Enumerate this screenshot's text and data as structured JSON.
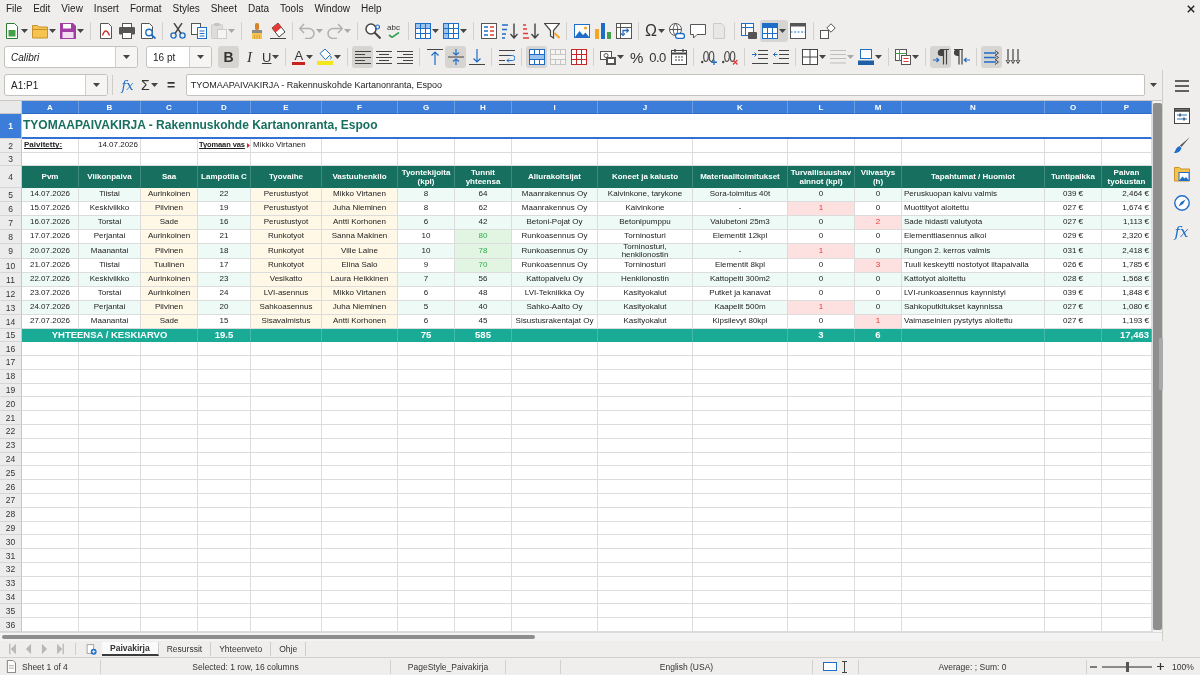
{
  "menu_bar": {
    "items": [
      "File",
      "Edit",
      "View",
      "Insert",
      "Format",
      "Styles",
      "Sheet",
      "Data",
      "Tools",
      "Window",
      "Help"
    ]
  },
  "standard_toolbar": {
    "groups": [
      [
        {
          "kind": "new",
          "dropdown": true,
          "pressed": false,
          "disabled": false
        },
        {
          "kind": "open",
          "dropdown": true,
          "pressed": false,
          "disabled": false
        },
        {
          "kind": "save",
          "dropdown": true,
          "pressed": false,
          "disabled": false
        }
      ],
      [
        {
          "kind": "pdf",
          "dropdown": false,
          "pressed": false,
          "disabled": false
        },
        {
          "kind": "print",
          "dropdown": false,
          "pressed": false,
          "disabled": false
        },
        {
          "kind": "preview",
          "dropdown": false,
          "pressed": false,
          "disabled": false
        }
      ],
      [
        {
          "kind": "cut",
          "dropdown": false,
          "pressed": false,
          "disabled": false
        },
        {
          "kind": "copy",
          "dropdown": false,
          "pressed": false,
          "disabled": false
        },
        {
          "kind": "paste",
          "dropdown": true,
          "pressed": false,
          "disabled": true
        }
      ],
      [
        {
          "kind": "clone",
          "dropdown": false,
          "pressed": false,
          "disabled": false
        },
        {
          "kind": "clear",
          "dropdown": false,
          "pressed": false,
          "disabled": false
        }
      ],
      [
        {
          "kind": "undo",
          "dropdown": true,
          "pressed": false,
          "disabled": true
        },
        {
          "kind": "redo",
          "dropdown": true,
          "pressed": false,
          "disabled": true
        }
      ],
      [
        {
          "kind": "find",
          "dropdown": false,
          "pressed": false,
          "disabled": false
        },
        {
          "kind": "spelling",
          "glyph": "abc",
          "dropdown": false,
          "pressed": false,
          "disabled": false
        }
      ],
      [
        {
          "kind": "rows",
          "dropdown": true,
          "pressed": false,
          "disabled": false
        },
        {
          "kind": "columns",
          "dropdown": true,
          "pressed": false,
          "disabled": false
        }
      ],
      [
        {
          "kind": "sort",
          "dropdown": false,
          "pressed": false,
          "disabled": false
        },
        {
          "kind": "ascending",
          "dropdown": false,
          "pressed": false,
          "disabled": false
        },
        {
          "kind": "descending",
          "dropdown": false,
          "pressed": false,
          "disabled": false
        },
        {
          "kind": "filter",
          "dropdown": false,
          "pressed": false,
          "disabled": false
        }
      ],
      [
        {
          "kind": "image",
          "dropdown": false,
          "pressed": false,
          "disabled": false
        },
        {
          "kind": "chart",
          "dropdown": false,
          "pressed": false,
          "disabled": false
        },
        {
          "kind": "pivot",
          "dropdown": false,
          "pressed": false,
          "disabled": false
        }
      ],
      [
        {
          "kind": "symbol",
          "glyph": "Ω",
          "dropdown": true,
          "pressed": false,
          "disabled": false
        },
        {
          "kind": "hyperlink",
          "dropdown": false,
          "pressed": false,
          "disabled": false
        },
        {
          "kind": "comment",
          "dropdown": false,
          "pressed": false,
          "disabled": false
        },
        {
          "kind": "headers",
          "dropdown": false,
          "pressed": false,
          "disabled": true
        }
      ],
      [
        {
          "kind": "printrange",
          "dropdown": false,
          "pressed": false,
          "disabled": false
        },
        {
          "kind": "freeze",
          "dropdown": true,
          "pressed": true,
          "disabled": false
        },
        {
          "kind": "split",
          "dropdown": false,
          "pressed": false,
          "disabled": false
        }
      ],
      [
        {
          "kind": "shapes",
          "dropdown": false,
          "pressed": false,
          "disabled": false
        }
      ]
    ]
  },
  "formatting_toolbar": {
    "font_name": "Calibri",
    "font_size": "16 pt",
    "groups": [
      [
        {
          "kind": "bold",
          "glyph": "B",
          "dropdown": false,
          "pressed": true,
          "disabled": false
        },
        {
          "kind": "italic",
          "glyph": "I",
          "dropdown": false,
          "pressed": false,
          "disabled": false
        },
        {
          "kind": "underline",
          "glyph": "U",
          "dropdown": true,
          "pressed": false,
          "disabled": false
        }
      ],
      [
        {
          "kind": "fontcolor",
          "glyph": "A",
          "dropdown": true,
          "pressed": false,
          "disabled": false
        },
        {
          "kind": "highlight",
          "dropdown": true,
          "pressed": false,
          "disabled": false
        }
      ],
      [
        {
          "kind": "left",
          "dropdown": false,
          "pressed": true,
          "disabled": false
        },
        {
          "kind": "center",
          "dropdown": false,
          "pressed": false,
          "disabled": false
        },
        {
          "kind": "right",
          "dropdown": false,
          "pressed": false,
          "disabled": false
        }
      ],
      [
        {
          "kind": "top",
          "dropdown": false,
          "pressed": false,
          "disabled": false
        },
        {
          "kind": "middle",
          "dropdown": false,
          "pressed": true,
          "disabled": false
        },
        {
          "kind": "bottom",
          "dropdown": false,
          "pressed": false,
          "disabled": false
        }
      ],
      [
        {
          "kind": "wrap",
          "dropdown": false,
          "pressed": false,
          "disabled": false
        }
      ],
      [
        {
          "kind": "mergecenter",
          "dropdown": false,
          "pressed": true,
          "disabled": false
        },
        {
          "kind": "merge",
          "dropdown": false,
          "pressed": false,
          "disabled": true
        },
        {
          "kind": "unmerge",
          "dropdown": false,
          "pressed": false,
          "disabled": false
        }
      ],
      [
        {
          "kind": "currency",
          "dropdown": true,
          "pressed": false,
          "disabled": false
        },
        {
          "kind": "percent",
          "glyph": "%",
          "dropdown": false,
          "pressed": false,
          "disabled": false
        },
        {
          "kind": "number",
          "glyph": "0.0",
          "dropdown": false,
          "pressed": false,
          "disabled": false
        },
        {
          "kind": "date",
          "dropdown": false,
          "pressed": false,
          "disabled": false
        }
      ],
      [
        {
          "kind": "adddecimal",
          "dropdown": false,
          "pressed": false,
          "disabled": false
        },
        {
          "kind": "deldecimal",
          "dropdown": false,
          "pressed": false,
          "disabled": false
        }
      ],
      [
        {
          "kind": "indent",
          "dropdown": false,
          "pressed": false,
          "disabled": false
        },
        {
          "kind": "outdent",
          "dropdown": false,
          "pressed": false,
          "disabled": false
        }
      ],
      [
        {
          "kind": "borders",
          "dropdown": true,
          "pressed": false,
          "disabled": false
        },
        {
          "kind": "borderstyle",
          "dropdown": true,
          "pressed": false,
          "disabled": true
        },
        {
          "kind": "bordercolor",
          "dropdown": true,
          "pressed": false,
          "disabled": false
        }
      ],
      [
        {
          "kind": "conditional",
          "dropdown": true,
          "pressed": false,
          "disabled": false
        }
      ],
      [
        {
          "kind": "ltr",
          "dropdown": false,
          "pressed": true,
          "disabled": false
        },
        {
          "kind": "rtl",
          "dropdown": false,
          "pressed": false,
          "disabled": false
        }
      ],
      [
        {
          "kind": "horizontal",
          "dropdown": false,
          "pressed": true,
          "disabled": false
        },
        {
          "kind": "vertical",
          "dropdown": false,
          "pressed": false,
          "disabled": false
        }
      ]
    ]
  },
  "formula_bar": {
    "name_box": "A1:P1",
    "buttons": [
      {
        "kind": "wizard",
        "glyph": "fx",
        "dropdown": false
      },
      {
        "kind": "sum",
        "glyph": "Σ",
        "dropdown": true
      },
      {
        "kind": "equals",
        "glyph": "=",
        "dropdown": false
      }
    ],
    "formula": "TYOMAAPAIVAKIRJA - Rakennuskohde Kartanonranta, Espoo"
  },
  "sidebar": {
    "buttons": [
      {
        "kind": "properties",
        "selected": false
      },
      {
        "kind": "styles",
        "selected": false
      },
      {
        "kind": "gallery",
        "selected": false
      },
      {
        "kind": "navigator",
        "selected": false
      },
      {
        "kind": "functions",
        "glyph": "fx",
        "selected": false
      }
    ]
  },
  "sheet": {
    "column_headers": [
      {
        "label": "A",
        "selected": true
      },
      {
        "label": "B",
        "selected": true
      },
      {
        "label": "C",
        "selected": true
      },
      {
        "label": "D",
        "selected": true
      },
      {
        "label": "E",
        "selected": true
      },
      {
        "label": "F",
        "selected": true
      },
      {
        "label": "G",
        "selected": true
      },
      {
        "label": "H",
        "selected": true
      },
      {
        "label": "I",
        "selected": true
      },
      {
        "label": "J",
        "selected": true
      },
      {
        "label": "K",
        "selected": true
      },
      {
        "label": "L",
        "selected": true
      },
      {
        "label": "M",
        "selected": true
      },
      {
        "label": "N",
        "selected": true
      },
      {
        "label": "O",
        "selected": true
      },
      {
        "label": "P",
        "selected": true
      }
    ],
    "row_headers": [
      {
        "label": "1",
        "selected": true
      },
      {
        "label": "2",
        "selected": false
      },
      {
        "label": "3",
        "selected": false
      },
      {
        "label": "4",
        "selected": false
      },
      {
        "label": "5",
        "selected": false
      },
      {
        "label": "6",
        "selected": false
      },
      {
        "label": "7",
        "selected": false
      },
      {
        "label": "8",
        "selected": false
      },
      {
        "label": "9",
        "selected": false
      },
      {
        "label": "10",
        "selected": false
      },
      {
        "label": "11",
        "selected": false
      },
      {
        "label": "12",
        "selected": false
      },
      {
        "label": "13",
        "selected": false
      },
      {
        "label": "14",
        "selected": false
      },
      {
        "label": "15",
        "selected": false
      },
      {
        "label": "16",
        "selected": false
      },
      {
        "label": "17",
        "selected": false
      },
      {
        "label": "18",
        "selected": false
      },
      {
        "label": "19",
        "selected": false
      },
      {
        "label": "20",
        "selected": false
      },
      {
        "label": "21",
        "selected": false
      },
      {
        "label": "22",
        "selected": false
      },
      {
        "label": "23",
        "selected": false
      },
      {
        "label": "24",
        "selected": false
      },
      {
        "label": "25",
        "selected": false
      },
      {
        "label": "26",
        "selected": false
      },
      {
        "label": "27",
        "selected": false
      },
      {
        "label": "28",
        "selected": false
      },
      {
        "label": "29",
        "selected": false
      },
      {
        "label": "30",
        "selected": false
      },
      {
        "label": "31",
        "selected": false
      },
      {
        "label": "32",
        "selected": false
      },
      {
        "label": "33",
        "selected": false
      },
      {
        "label": "34",
        "selected": false
      },
      {
        "label": "35",
        "selected": false
      },
      {
        "label": "36",
        "selected": false
      }
    ],
    "title": "TYOMAAPAIVAKIRJA - Rakennuskohde Kartanonranta, Espoo",
    "info": {
      "updated": {
        "label": "Paivitetty:",
        "value": "14.07.2026"
      },
      "manager": {
        "label": "Tyomaan vas",
        "label_clipped": true,
        "value": "Mikko Virtanen"
      }
    },
    "table": {
      "columns": [
        "Pvm",
        "Viikonpaiva",
        "Saa",
        "Lampotila C",
        "Tyovaihe",
        "Vastuuhenkilo",
        "Tyontekijoita (kpl)",
        "Tunnit yhteensa",
        "Aliurakoitsijat",
        "Koneet ja kalusto",
        "Materiaalitoimitukset",
        "Turvallisuushavainnot (kpl)",
        "Viivastys (h)",
        "Tapahtumat / Huomiot",
        "Tuntipalkka",
        "Paivan tyokustan"
      ],
      "rows": [
        {
          "cells": [
            "14.07.2026",
            "Tiistai",
            "Aurinkoinen",
            "22",
            "Perustustyot",
            "Mikko Virtanen",
            "8",
            "64",
            "Maanrakennus Oy",
            "Kaivinkone, tarykone",
            "Sora-toimitus 40t",
            "0",
            "0",
            "Peruskuopan kaivu valmis",
            "039 €",
            "2,464 €"
          ],
          "hours_high": false,
          "incident": false,
          "delayed": false
        },
        {
          "cells": [
            "15.07.2026",
            "Keskiviikko",
            "Pilvinen",
            "19",
            "Perustustyot",
            "Juha Nieminen",
            "8",
            "62",
            "Maanrakennus Oy",
            "Kaivinkone",
            "-",
            "1",
            "0",
            "Muottityot aloitettu",
            "027 €",
            "1,674 €"
          ],
          "hours_high": false,
          "incident": true,
          "delayed": false
        },
        {
          "cells": [
            "16.07.2026",
            "Torstai",
            "Sade",
            "16",
            "Perustustyot",
            "Antti Korhonen",
            "6",
            "42",
            "Betoni-Pojat Oy",
            "Betonipumppu",
            "Valubetoni 25m3",
            "0",
            "2",
            "Sade hidasti valutyota",
            "027 €",
            "1,113 €"
          ],
          "hours_high": false,
          "incident": false,
          "delayed": true
        },
        {
          "cells": [
            "17.07.2026",
            "Perjantai",
            "Aurinkoinen",
            "21",
            "Runkotyot",
            "Sanna Makinen",
            "10",
            "80",
            "Runkoasennus Oy",
            "Torninosturi",
            "Elementit 12kpl",
            "0",
            "0",
            "Elementtiasennus alkoi",
            "029 €",
            "2,320 €"
          ],
          "hours_high": true,
          "incident": false,
          "delayed": false
        },
        {
          "cells": [
            "20.07.2026",
            "Maanantai",
            "Pilvinen",
            "18",
            "Runkotyot",
            "Ville Laine",
            "10",
            "78",
            "Runkoasennus Oy",
            "Torninosturi, henkilonostin",
            "-",
            "1",
            "0",
            "Rungon 2. kerros valmis",
            "031 €",
            "2,418 €"
          ],
          "hours_high": true,
          "incident": true,
          "delayed": false
        },
        {
          "cells": [
            "21.07.2026",
            "Tiistai",
            "Tuulinen",
            "17",
            "Runkotyot",
            "Elina Salo",
            "9",
            "70",
            "Runkoasennus Oy",
            "Torninosturi",
            "Elementit 8kpl",
            "0",
            "3",
            "Tuuli keskeytti nostotyot iltapaivalla",
            "026 €",
            "1,785 €"
          ],
          "hours_high": true,
          "incident": false,
          "delayed": true
        },
        {
          "cells": [
            "22.07.2026",
            "Keskiviikko",
            "Aurinkoinen",
            "23",
            "Vesikatto",
            "Laura Heikkinen",
            "7",
            "56",
            "Kattopalvelu Oy",
            "Henkilonostin",
            "Kattopelti 300m2",
            "0",
            "0",
            "Kattotyot aloitettu",
            "028 €",
            "1,568 €"
          ],
          "hours_high": false,
          "incident": false,
          "delayed": false
        },
        {
          "cells": [
            "23.07.2026",
            "Torstai",
            "Aurinkoinen",
            "24",
            "LVI-asennus",
            "Mikko Virtanen",
            "6",
            "48",
            "LVI-Tekniikka Oy",
            "Kasityokalut",
            "Putket ja kanavat",
            "0",
            "0",
            "LVI-runkoasennus kaynnistyi",
            "039 €",
            "1,848 €"
          ],
          "hours_high": false,
          "incident": false,
          "delayed": false
        },
        {
          "cells": [
            "24.07.2026",
            "Perjantai",
            "Pilvinen",
            "20",
            "Sahkoasennus",
            "Juha Nieminen",
            "5",
            "40",
            "Sahko-Aalto Oy",
            "Kasityokalut",
            "Kaapelit 500m",
            "1",
            "0",
            "Sahkoputkitukset kaynnissa",
            "027 €",
            "1,080 €"
          ],
          "hours_high": false,
          "incident": true,
          "delayed": false
        },
        {
          "cells": [
            "27.07.2026",
            "Maanantai",
            "Sade",
            "15",
            "Sisavalmistus",
            "Antti Korhonen",
            "6",
            "45",
            "Sisustusrakentajat Oy",
            "Kasityokalut",
            "Kipsilevyt 80kpl",
            "0",
            "1",
            "Vaimaseinien pystytys aloitettu",
            "027 €",
            "1,193 €"
          ],
          "hours_high": false,
          "incident": false,
          "delayed": true
        }
      ],
      "totals": {
        "label": "YHTEENSA / KESKIARVO",
        "temperature": "19.5",
        "workers": "75",
        "hours": "585",
        "incidents": "3",
        "delay": "6",
        "cost": "17,463"
      }
    }
  },
  "sheet_tabs": {
    "navigation": [
      {
        "kind": "first",
        "disabled": true
      },
      {
        "kind": "previous",
        "disabled": true
      },
      {
        "kind": "next",
        "disabled": true
      },
      {
        "kind": "last",
        "disabled": true
      }
    ],
    "tabs": [
      {
        "label": "Paivakirja",
        "selected": true
      },
      {
        "label": "Resurssit",
        "selected": false
      },
      {
        "label": "Yhteenveto",
        "selected": false
      },
      {
        "label": "Ohje",
        "selected": false
      }
    ]
  },
  "status_bar": {
    "sheet_position": "Sheet 1 of 4",
    "selection": "Selected: 1 row, 16 columns",
    "page_style": "PageStyle_Paivakirja",
    "language": "English (USA)",
    "summary": "Average: ; Sum: 0",
    "zoom": {
      "level": 0.5,
      "reading": "100%"
    }
  }
}
